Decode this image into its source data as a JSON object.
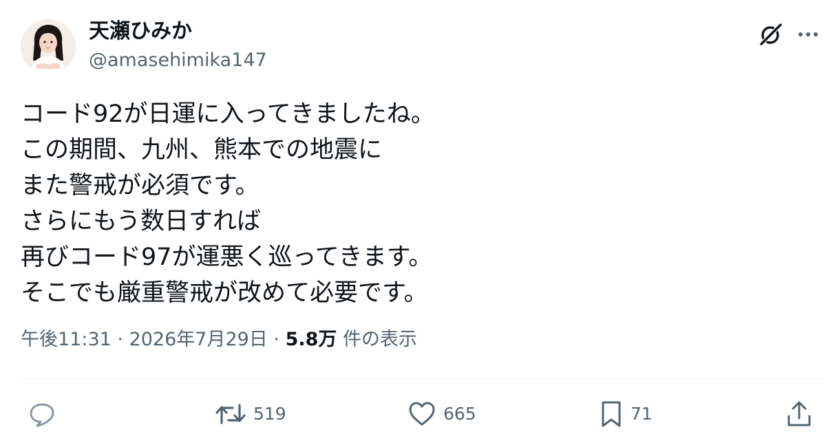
{
  "author": {
    "display_name": "天瀬ひみか",
    "handle": "@amasehimika147"
  },
  "icons": {
    "avatar": "profile-photo",
    "grok": "grok-icon",
    "more": "more-dots-icon",
    "reply": "reply-bubble-icon",
    "retweet": "retweet-arrows-icon",
    "like": "heart-icon",
    "bookmark": "bookmark-icon",
    "share": "share-upload-icon"
  },
  "tweet": {
    "lines": [
      "コード92が日運に入ってきましたね。",
      "この期間、九州、熊本での地震に",
      "また警戒が必須です。",
      "さらにもう数日すれば",
      "再びコード97が運悪く巡ってきます。",
      "そこでも厳重警戒が改めて必要です。"
    ]
  },
  "meta": {
    "time": "午後11:31",
    "separator": " · ",
    "date": "2026年7月29日",
    "views_count": "5.8万",
    "views_label": " 件の表示"
  },
  "actions": {
    "reply_count": "",
    "retweet_count": "519",
    "like_count": "665",
    "bookmark_count": "71"
  },
  "colors": {
    "text_primary": "#0f1419",
    "text_secondary": "#536471",
    "divider": "#eff3f4"
  }
}
